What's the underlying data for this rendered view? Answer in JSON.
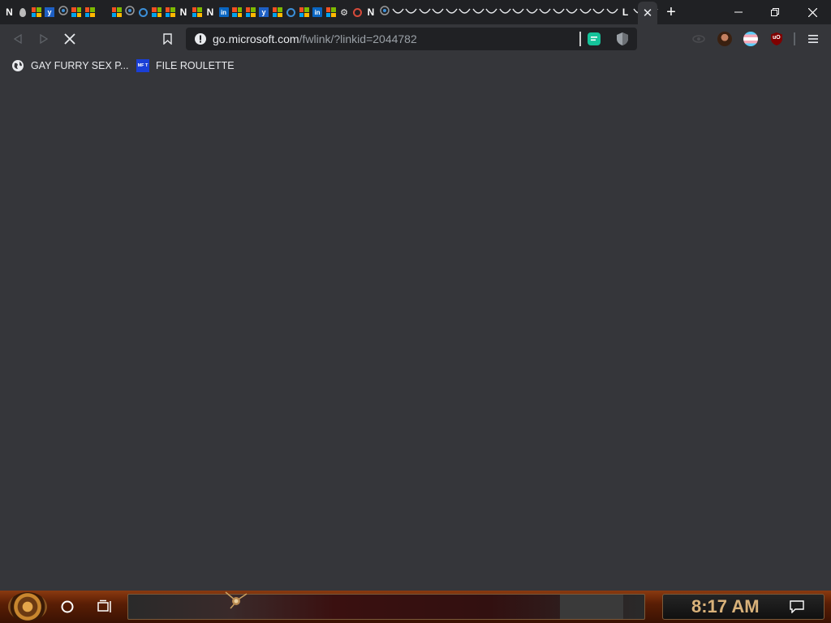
{
  "tabstrip": {
    "tabs": [
      {
        "icon": "n-icon"
      },
      {
        "icon": "drop-icon"
      },
      {
        "icon": "microsoft-icon"
      },
      {
        "icon": "yammer-icon"
      },
      {
        "icon": "generic-icon"
      },
      {
        "icon": "microsoft-icon"
      },
      {
        "icon": "microsoft-icon"
      },
      {
        "icon": "blank-icon"
      },
      {
        "icon": "microsoft-icon"
      },
      {
        "icon": "generic-icon"
      },
      {
        "icon": "ring-icon"
      },
      {
        "icon": "microsoft-icon"
      },
      {
        "icon": "microsoft-icon"
      },
      {
        "icon": "n-icon"
      },
      {
        "icon": "microsoft-icon"
      },
      {
        "icon": "n-icon"
      },
      {
        "icon": "linkedin-icon"
      },
      {
        "icon": "microsoft-icon"
      },
      {
        "icon": "microsoft-icon"
      },
      {
        "icon": "yammer-icon"
      },
      {
        "icon": "microsoft-icon"
      },
      {
        "icon": "ring-icon"
      },
      {
        "icon": "microsoft-icon"
      },
      {
        "icon": "linkedin-icon"
      },
      {
        "icon": "microsoft-icon"
      },
      {
        "icon": "gear-icon"
      },
      {
        "icon": "red-ring-icon"
      },
      {
        "icon": "n-icon"
      },
      {
        "icon": "generic-icon"
      },
      {
        "icon": "sleep-icon"
      },
      {
        "icon": "sleep-icon"
      },
      {
        "icon": "sleep-icon"
      },
      {
        "icon": "sleep-icon"
      },
      {
        "icon": "sleep-icon"
      },
      {
        "icon": "sleep-icon"
      },
      {
        "icon": "sleep-icon"
      },
      {
        "icon": "sleep-icon"
      },
      {
        "icon": "sleep-icon"
      },
      {
        "icon": "sleep-icon"
      },
      {
        "icon": "sleep-icon"
      },
      {
        "icon": "sleep-icon"
      },
      {
        "icon": "sleep-icon"
      },
      {
        "icon": "sleep-icon"
      },
      {
        "icon": "sleep-icon"
      },
      {
        "icon": "sleep-icon"
      },
      {
        "icon": "sleep-icon"
      },
      {
        "icon": "l-icon"
      },
      {
        "icon": "sleep-icon"
      },
      {
        "icon": "sleep-icon"
      }
    ],
    "l_label": "L",
    "n_label": "N",
    "in_label": "in",
    "y_label": "y",
    "active_tab_icon": "loading-close-icon"
  },
  "window_controls": {
    "minimize": "minimize-icon",
    "restore": "restore-icon",
    "close": "close-icon"
  },
  "toolbar": {
    "address": {
      "host": "go.microsoft.com",
      "path": "/fwlink/?linkid=2044782"
    },
    "extensions": [
      "grammarly-icon",
      "privacy-shield-icon",
      "eye-icon",
      "avatar-icon",
      "trans-flag-icon",
      "ublock-icon"
    ],
    "ublock_label": "uO"
  },
  "bookmarks": [
    {
      "label": "GAY FURRY SEX P...",
      "icon": "globe-icon"
    },
    {
      "label": "FILE ROULETTE",
      "icon": "file-roulette-icon",
      "icon_text": "MF T"
    }
  ],
  "taskbar": {
    "clock": "8:17 AM",
    "accent": "#d9b27a"
  }
}
